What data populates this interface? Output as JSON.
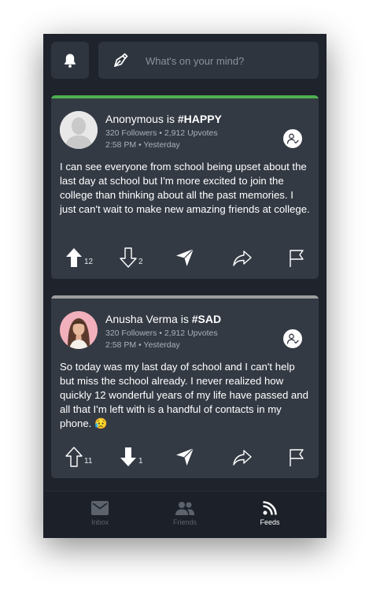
{
  "header": {
    "compose_placeholder": "What's on your mind?"
  },
  "posts": [
    {
      "author": "Anonymous",
      "connector": "is",
      "mood": "#HAPPY",
      "stats": "320 Followers • 2,912 Upvotes",
      "time": "2:58 PM • Yesterday",
      "body": "I can see everyone from school being upset about the last day at school but I'm more excited to join the college than thinking about all the past memories. I just can't wait to make new amazing friends at college.",
      "upvotes": "12",
      "downvotes": "2",
      "accent_color": "#4caf50",
      "upvoted": true,
      "downvoted": false
    },
    {
      "author": "Anusha Verma",
      "connector": "is",
      "mood": "#SAD",
      "stats": "320 Followers • 2,912 Upvotes",
      "time": "2:58 PM • Yesterday",
      "body": "So today was my last day of school and I can't help but miss the school already. I never realized how quickly 12 wonderful years of my life have passed and all that I'm left with is a handful of contacts in my phone. 😥",
      "upvotes": "11",
      "downvotes": "1",
      "accent_color": "#9e9e9e",
      "upvoted": false,
      "downvoted": true
    }
  ],
  "nav": {
    "items": [
      {
        "label": "Inbox",
        "icon": "mail-icon",
        "active": false
      },
      {
        "label": "Friends",
        "icon": "people-icon",
        "active": false
      },
      {
        "label": "Feeds",
        "icon": "rss-icon",
        "active": true
      }
    ]
  },
  "colors": {
    "background": "#1e232c",
    "card": "#343a44",
    "input": "#2f353f",
    "nav_inactive": "#5d636c",
    "nav_active": "#ffffff"
  }
}
